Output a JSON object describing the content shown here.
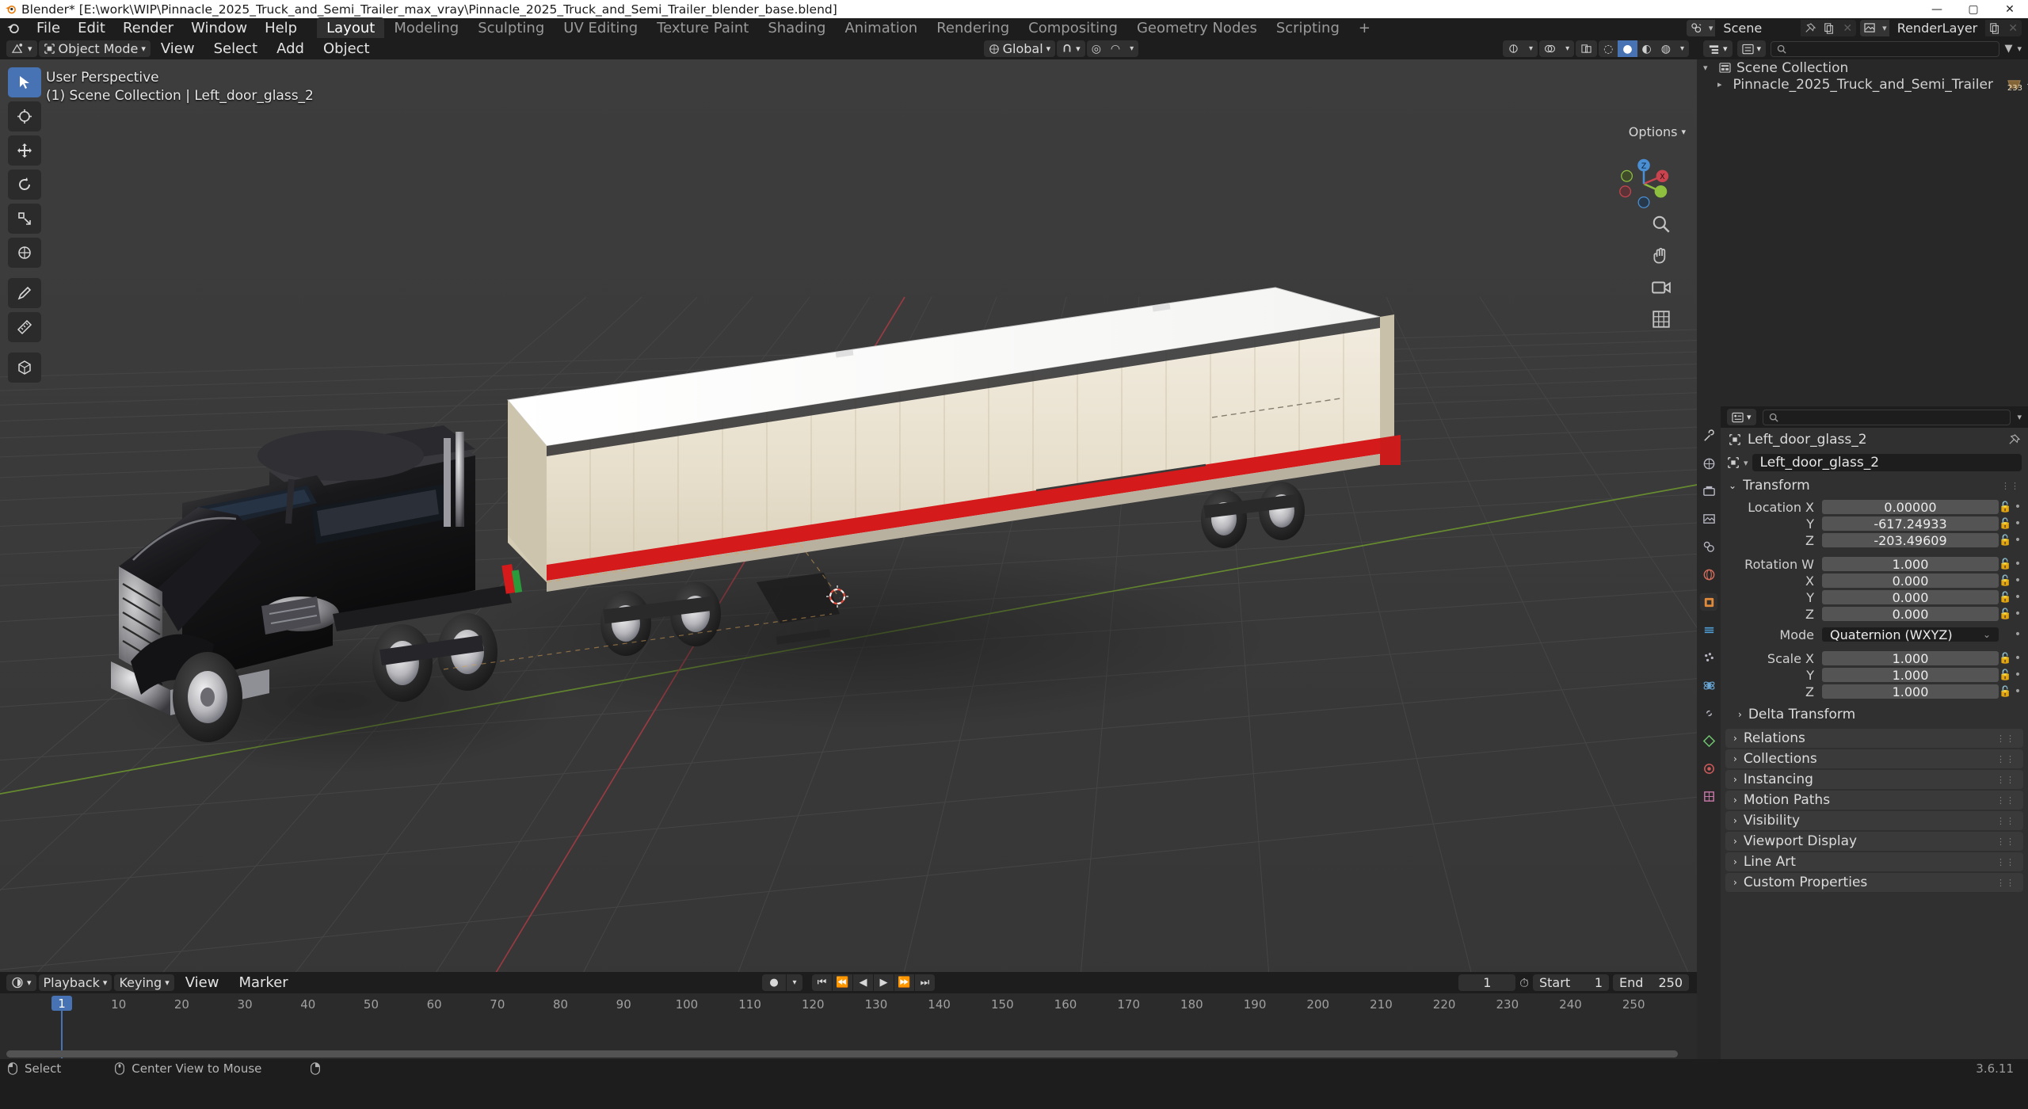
{
  "window": {
    "title": "Blender* [E:\\work\\WIP\\Pinnacle_2025_Truck_and_Semi_Trailer_max_vray\\Pinnacle_2025_Truck_and_Semi_Trailer_blender_base.blend]",
    "minimize": "—",
    "maximize": "▢",
    "close": "✕"
  },
  "topbar": {
    "menus": [
      "File",
      "Edit",
      "Render",
      "Window",
      "Help"
    ],
    "workspaces": [
      {
        "label": "Layout",
        "active": true
      },
      {
        "label": "Modeling",
        "active": false
      },
      {
        "label": "Sculpting",
        "active": false
      },
      {
        "label": "UV Editing",
        "active": false
      },
      {
        "label": "Texture Paint",
        "active": false
      },
      {
        "label": "Shading",
        "active": false
      },
      {
        "label": "Animation",
        "active": false
      },
      {
        "label": "Rendering",
        "active": false
      },
      {
        "label": "Compositing",
        "active": false
      },
      {
        "label": "Geometry Nodes",
        "active": false
      },
      {
        "label": "Scripting",
        "active": false
      },
      {
        "label": "+",
        "active": false
      }
    ],
    "scene_field": "Scene",
    "viewlayer_field": "RenderLayer"
  },
  "viewport": {
    "mode": "Object Mode",
    "menus": [
      "View",
      "Select",
      "Add",
      "Object"
    ],
    "transform_orientation": "Global",
    "overlay_line1": "User Perspective",
    "overlay_line2": "(1) Scene Collection | Left_door_glass_2",
    "options_label": "Options",
    "gizmo_axes": {
      "x": "X",
      "y": "Y",
      "z": "Z"
    },
    "tools": [
      "tweak-select-tool",
      "cursor-tool",
      "move-tool",
      "rotate-tool",
      "scale-tool",
      "transform-tool",
      "annotate-tool",
      "measure-tool",
      "add-cube-tool"
    ]
  },
  "timeline": {
    "editor_menus": [
      "Playback",
      "Keying",
      "View",
      "Marker"
    ],
    "ticks": [
      10,
      20,
      30,
      40,
      50,
      60,
      70,
      80,
      90,
      100,
      110,
      120,
      130,
      140,
      150,
      160,
      170,
      180,
      190,
      200,
      210,
      220,
      230,
      240,
      250
    ],
    "current_frame": "1",
    "current_frame_field": "1",
    "start_label": "Start",
    "start_value": "1",
    "end_label": "End",
    "end_value": "250"
  },
  "outliner": {
    "root_label": "Scene Collection",
    "items": [
      {
        "label": "Pinnacle_2025_Truck_and_Semi_Trailer",
        "badge": "233"
      }
    ]
  },
  "properties": {
    "breadcrumb": "Left_door_glass_2",
    "object_name": "Left_door_glass_2",
    "transform_title": "Transform",
    "location": [
      {
        "label": "Location X",
        "value": "0.00000"
      },
      {
        "label": "Y",
        "value": "-617.24933"
      },
      {
        "label": "Z",
        "value": "-203.49609"
      }
    ],
    "rotation": [
      {
        "label": "Rotation W",
        "value": "1.000"
      },
      {
        "label": "X",
        "value": "0.000"
      },
      {
        "label": "Y",
        "value": "0.000"
      },
      {
        "label": "Z",
        "value": "0.000"
      }
    ],
    "mode_label": "Mode",
    "mode_value": "Quaternion (WXYZ)",
    "scale": [
      {
        "label": "Scale X",
        "value": "1.000"
      },
      {
        "label": "Y",
        "value": "1.000"
      },
      {
        "label": "Z",
        "value": "1.000"
      }
    ],
    "delta_transform": "Delta Transform",
    "panels": [
      "Relations",
      "Collections",
      "Instancing",
      "Motion Paths",
      "Visibility",
      "Viewport Display",
      "Line Art",
      "Custom Properties"
    ]
  },
  "statusbar": {
    "select_label": "Select",
    "center_view_label": "Center View to Mouse",
    "version": "3.6.11"
  },
  "colors": {
    "accent": "#4772b3",
    "header": "#1d1d1d",
    "panel": "#303030",
    "viewport_bg": "#393939",
    "trailer_body": "#efe9d8",
    "trailer_stripe": "#d41a1a",
    "axis_x": "#aa3b44",
    "axis_y": "#6f9a2e"
  }
}
